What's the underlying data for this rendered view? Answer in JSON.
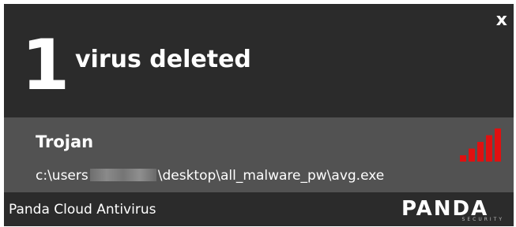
{
  "notification": {
    "close_label": "x",
    "count": "1",
    "headline": "virus deleted"
  },
  "threat": {
    "name": "Trojan",
    "path_prefix": "c:\\users",
    "path_suffix": "\\desktop\\all_malware_pw\\avg.exe",
    "severity_level": 5,
    "severity_max": 5,
    "severity_color": "#e01010"
  },
  "footer": {
    "app_name": "Panda Cloud Antivirus",
    "logo_text": "PANDA",
    "logo_subtext": "SECURITY"
  }
}
